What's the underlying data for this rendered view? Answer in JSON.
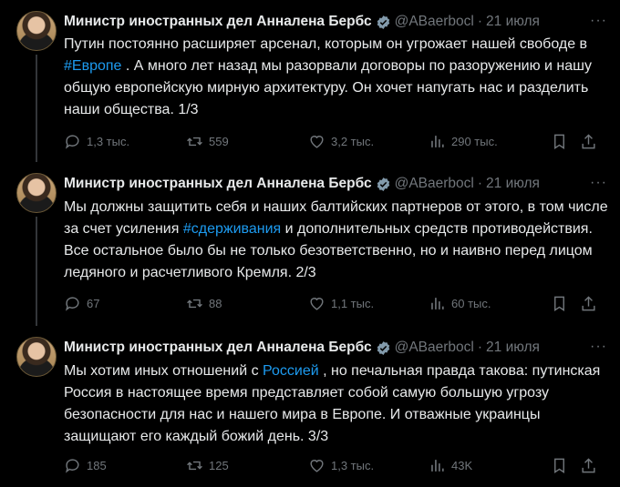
{
  "tweets": [
    {
      "author": "Министр иностранных дел Анналена Бербс",
      "handle": "@ABaerbocl",
      "dot": "·",
      "date": "21 июля",
      "more": "···",
      "text_parts": [
        "Путин постоянно расширяет арсенал, которым он угрожает нашей свободе в ",
        "#Европе",
        " . А много лет назад мы разорвали договоры по разоружению и нашу общую европейскую мирную архитектуру. Он хочет напугать нас и разделить наши общества. 1/3"
      ],
      "replies": "1,3 тыс.",
      "reposts": "559",
      "likes": "3,2 тыс.",
      "views": "290 тыс."
    },
    {
      "author": "Министр иностранных дел Анналена Бербс",
      "handle": "@ABaerbocl",
      "dot": "·",
      "date": "21 июля",
      "more": "···",
      "text_parts": [
        "Мы должны защитить себя и наших балтийских партнеров от этого, в том числе за счет усиления ",
        "#сдерживания",
        " и дополнительных средств противодействия. Все остальное было бы не только безответственно, но и наивно перед лицом ледяного и расчетливого Кремля. 2/3"
      ],
      "replies": "67",
      "reposts": "88",
      "likes": "1,1 тыс.",
      "views": "60 тыс."
    },
    {
      "author": "Министр иностранных дел Анналена Бербс",
      "handle": "@ABaerbocl",
      "dot": "·",
      "date": "21 июля",
      "more": "···",
      "text_parts": [
        "Мы хотим иных отношений с ",
        "Россией",
        " , но печальная правда такова: путинская Россия в настоящее время представляет собой самую большую угрозу безопасности для нас и нашего мира в Европе. И отважные украинцы защищают его каждый божий день. 3/3"
      ],
      "replies": "185",
      "reposts": "125",
      "likes": "1,3 тыс.",
      "views": "43K"
    }
  ],
  "icons": [
    "reply-icon",
    "repost-icon",
    "like-icon",
    "views-icon",
    "bookmark-icon",
    "share-icon",
    "verified-badge-icon"
  ],
  "colors": {
    "background": "#000000",
    "text": "#e7e9ea",
    "muted": "#71767b",
    "link": "#1d9bf0",
    "verified": "#829aab"
  }
}
